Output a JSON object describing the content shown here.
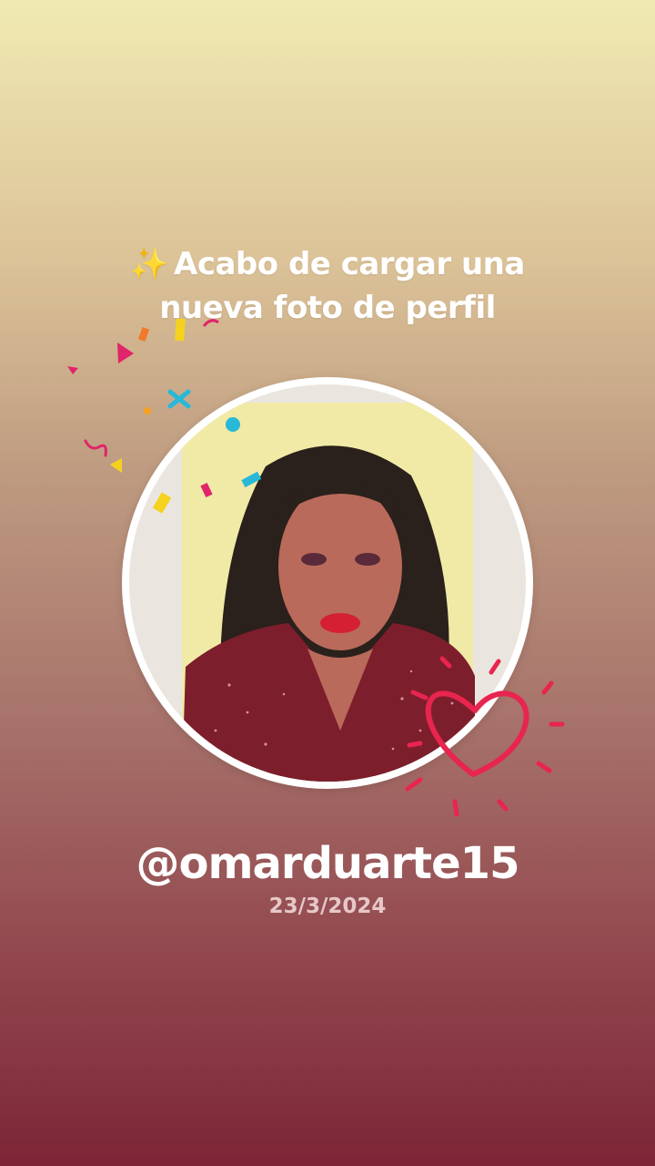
{
  "headline": {
    "sparkle_icon": "sparkles-icon",
    "sparkle_glyph": "✨",
    "line1": "Acabo de cargar una",
    "line2": "nueva foto de perfil"
  },
  "profile": {
    "username": "@omarduarte15",
    "date": "23/3/2024"
  },
  "colors": {
    "background_top": "#f0eab2",
    "background_bottom": "#7c2536",
    "heart_accent": "#e8254f",
    "confetti": [
      "#e0256a",
      "#f5d21e",
      "#29b8d8",
      "#f07a2a"
    ]
  }
}
